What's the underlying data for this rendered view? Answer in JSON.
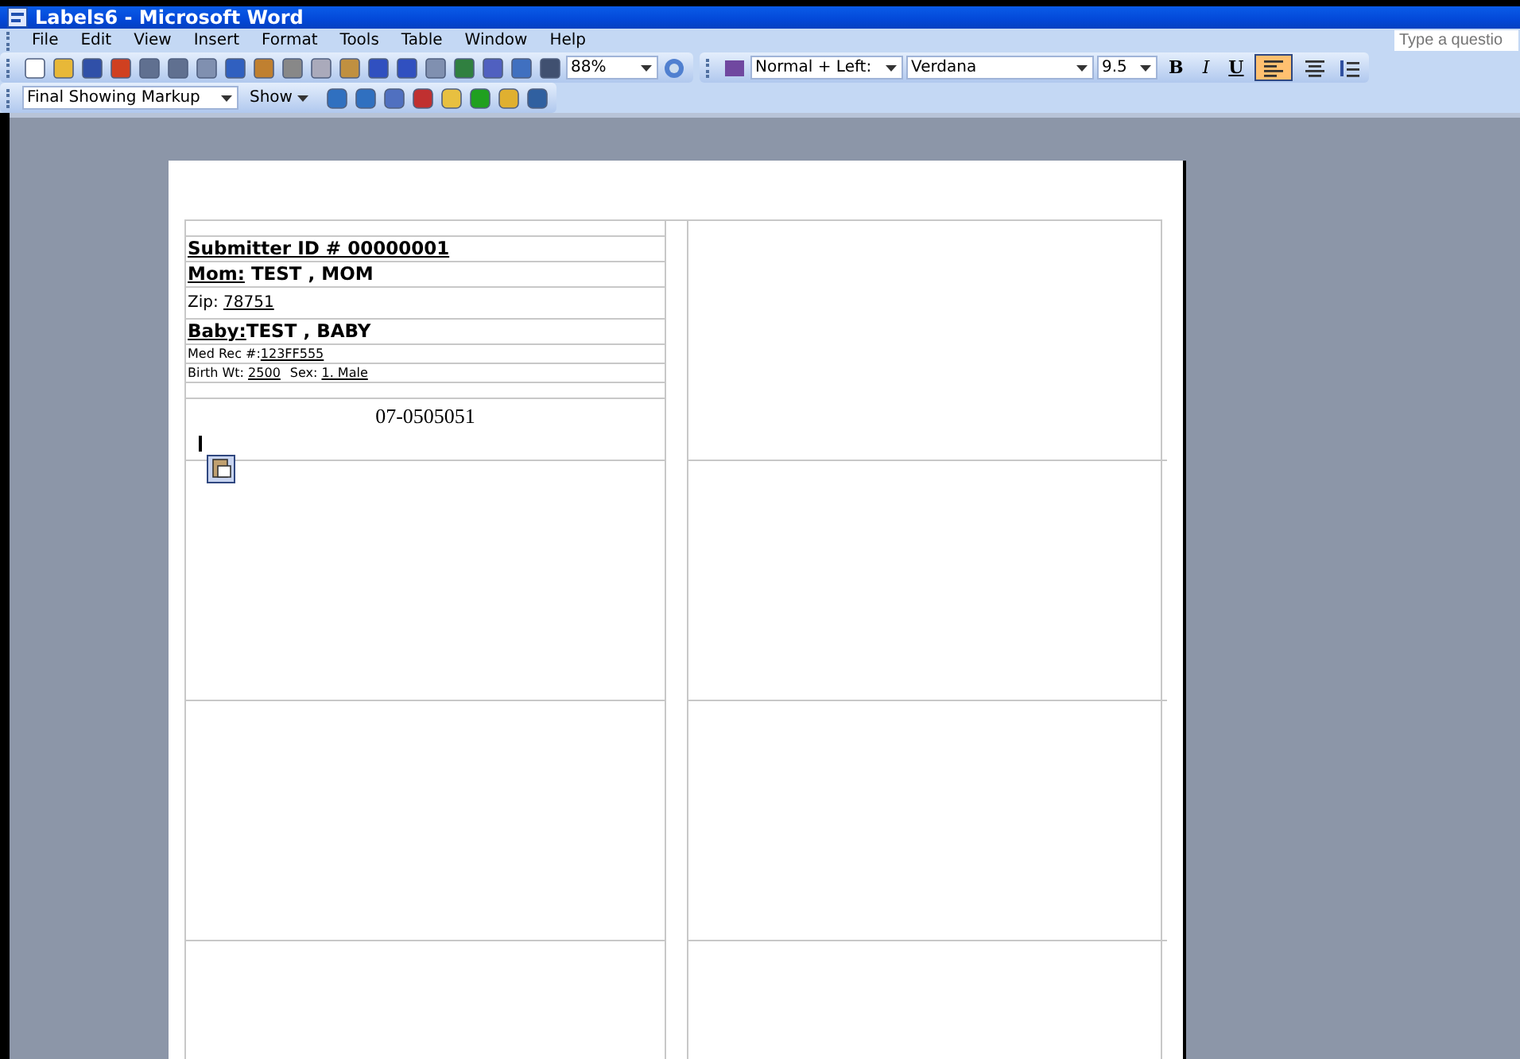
{
  "window": {
    "title": "Labels6 - Microsoft Word"
  },
  "menu": [
    "File",
    "Edit",
    "View",
    "Insert",
    "Format",
    "Tools",
    "Table",
    "Window",
    "Help"
  ],
  "help_box": {
    "placeholder": "Type a questio"
  },
  "standard_toolbar": {
    "zoom": "88%"
  },
  "formatting_toolbar": {
    "style": "Normal + Left:",
    "font": "Verdana",
    "size": "9.5",
    "buttons": [
      {
        "label": "B",
        "kind": "bold",
        "selected": false
      },
      {
        "label": "I",
        "kind": "italic",
        "selected": false
      },
      {
        "label": "U",
        "kind": "underline",
        "selected": false
      }
    ],
    "align": [
      {
        "kind": "left",
        "selected": true
      },
      {
        "kind": "center",
        "selected": false
      }
    ]
  },
  "reviewing_toolbar": {
    "display": "Final Showing Markup",
    "show": "Show"
  },
  "label": {
    "lines": [
      {
        "parts": [
          {
            "text": "Submitter ID # 00000001",
            "bold": true,
            "underline": true
          }
        ]
      },
      {
        "parts": [
          {
            "text": "Mom:",
            "bold": true,
            "underline": true
          },
          {
            "text": " TEST , MOM",
            "bold": true,
            "underline": false
          }
        ]
      },
      {
        "parts": [
          {
            "text": "Zip: ",
            "bold": false,
            "underline": false
          },
          {
            "text": "78751",
            "bold": false,
            "underline": true
          }
        ]
      },
      {
        "parts": [
          {
            "text": "Baby:",
            "bold": true,
            "underline": true
          },
          {
            "text": "TEST , BABY",
            "bold": true,
            "underline": false
          }
        ]
      },
      {
        "parts": [
          {
            "text": "Med Rec #:",
            "bold": false,
            "underline": false
          },
          {
            "text": "123FF555",
            "bold": false,
            "underline": true
          }
        ]
      },
      {
        "parts": [
          {
            "text": "Birth Wt: ",
            "bold": false,
            "underline": false
          },
          {
            "text": "2500",
            "bold": false,
            "underline": true
          },
          {
            "text": "Sex: ",
            "bold": false,
            "underline": false
          },
          {
            "text": "1. Male",
            "bold": false,
            "underline": true
          }
        ]
      }
    ],
    "number": "07-0505051"
  }
}
